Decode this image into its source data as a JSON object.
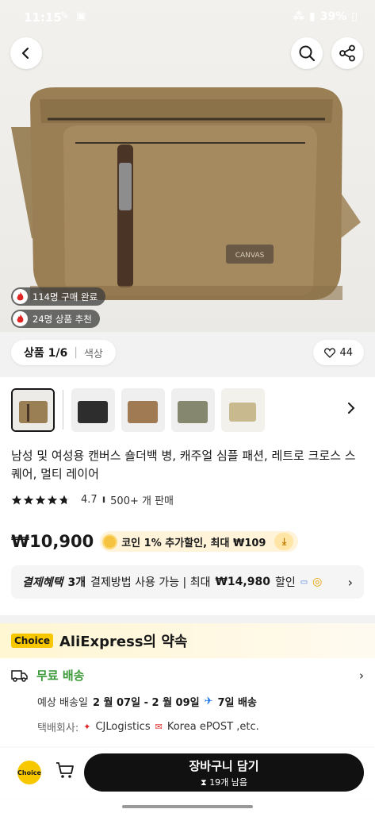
{
  "status_bar": {
    "time": "11:15",
    "battery": "39%"
  },
  "header": {
    "back_icon": "chevron-left-icon",
    "search_icon": "search-icon",
    "share_icon": "share-icon"
  },
  "badges": {
    "purchases": "114명 구매 완료",
    "recommend": "24명 상품 추천"
  },
  "gallery": {
    "label": "상품 1/6",
    "sub_label": "색상",
    "likes": "44"
  },
  "product": {
    "title": "남성 및 여성용 캔버스 숄더백 병, 캐주얼 심플 패션, 레트로 크로스 스퀘어, 멀티 레이어",
    "rating": "4.7",
    "rating_stars": 4.7,
    "sold": "500+ 개 판매",
    "price": "₩10,900",
    "coin_text": "코인 1% 추가할인, 최대 ₩109"
  },
  "payment": {
    "label": "결제혜택",
    "count": "3개",
    "text": "결제방법 사용 가능 | 최대",
    "max": "₩14,980",
    "suffix": "할인"
  },
  "promise": {
    "badge": "Choice",
    "title": "AliExpress의 약속"
  },
  "shipping": {
    "title": "무료 배송",
    "eta_label": "예상 배송일",
    "eta_dates": "2 월 07일 - 2 월 09일",
    "eta_days": "7일 배송",
    "carrier_label": "택배회사:",
    "carrier1": "CJLogistics",
    "carrier2": "Korea ePOST ,etc."
  },
  "bottom": {
    "choice": "Choice",
    "cart_label": "장바구니 담기",
    "remaining": "19개 남음"
  },
  "colors": {
    "accent_dark": "#111111",
    "free_ship_green": "#3c9a3a",
    "choice_yellow": "#f7c700"
  }
}
